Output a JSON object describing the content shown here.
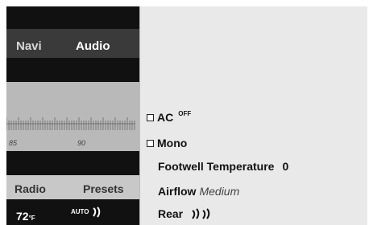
{
  "top_menu": {
    "navi": "Navi",
    "audio": "Audio"
  },
  "scale": {
    "tick_85": "85",
    "tick_90": "90"
  },
  "bottom_menu": {
    "radio": "Radio",
    "presets": "Presets"
  },
  "climate": {
    "temperature": "72",
    "unit": "°F",
    "auto": "AUTO"
  },
  "menu": {
    "ac_label": "AC",
    "ac_state": "OFF",
    "mono_label": "Mono",
    "footwell_label": "Footwell Temperature",
    "footwell_value": "0",
    "airflow_label": "Airflow",
    "airflow_value": "Medium",
    "rear_label": "Rear"
  }
}
